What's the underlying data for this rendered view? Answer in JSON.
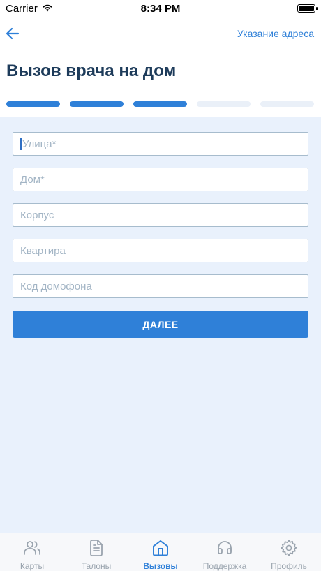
{
  "status_bar": {
    "carrier": "Carrier",
    "time": "8:34 PM"
  },
  "nav": {
    "title": "Указание адреса",
    "back_icon": "arrow-left-icon"
  },
  "page_title": "Вызов врача на дом",
  "progress": {
    "total_steps": 5,
    "completed_steps": 3
  },
  "form": {
    "fields": [
      {
        "name": "street",
        "placeholder": "Улица*",
        "value": ""
      },
      {
        "name": "house",
        "placeholder": "Дом*",
        "value": ""
      },
      {
        "name": "building",
        "placeholder": "Корпус",
        "value": ""
      },
      {
        "name": "apartment",
        "placeholder": "Квартира",
        "value": ""
      },
      {
        "name": "intercom",
        "placeholder": "Код домофона",
        "value": ""
      }
    ],
    "submit_label": "ДАЛЕЕ"
  },
  "tabs": [
    {
      "label": "Карты",
      "icon": "users-icon",
      "active": false
    },
    {
      "label": "Талоны",
      "icon": "document-icon",
      "active": false
    },
    {
      "label": "Вызовы",
      "icon": "home-icon",
      "active": true
    },
    {
      "label": "Поддержка",
      "icon": "headphones-icon",
      "active": false
    },
    {
      "label": "Профиль",
      "icon": "gear-icon",
      "active": false
    }
  ],
  "colors": {
    "accent": "#2f80d8",
    "title": "#1d3b5a",
    "content_bg": "#e9f1fc"
  }
}
